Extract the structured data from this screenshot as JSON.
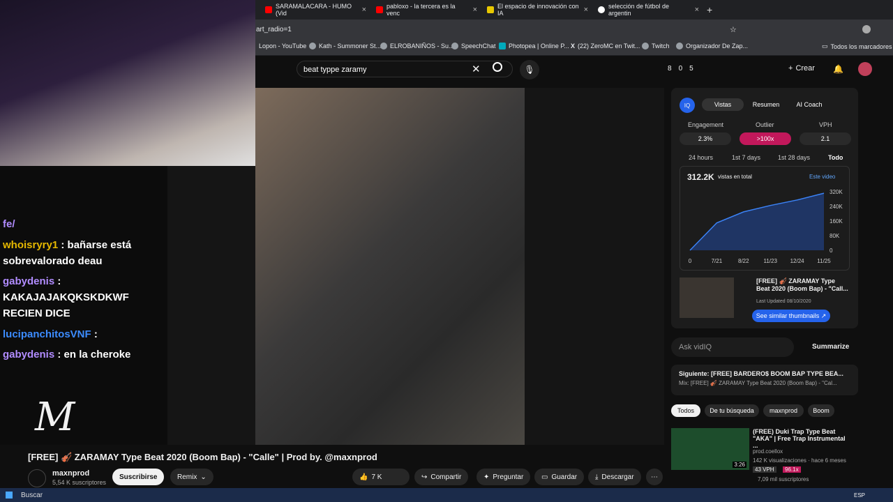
{
  "tabs": [
    {
      "label": "SARAMALACARA - HUMO (Vid",
      "color": "#ff0000"
    },
    {
      "label": "pabloxo - la tercera es la venc",
      "color": "#ff0000"
    },
    {
      "label": "El espacio de innovación con IA",
      "color": "#e8c800"
    },
    {
      "label": "selección de fútbol de argentin",
      "color": "#fff"
    }
  ],
  "address": {
    "text": "art_radio=1"
  },
  "bookmarks": [
    "Lopon - YouTube",
    "Kath - Summoner St...",
    "ELROBANIÑOS - Su...",
    "SpeechChat",
    "Photopea | Online P...",
    "(22) ZeroMC en Twit...",
    "Twitch",
    "Organizador De Zap..."
  ],
  "bookmarks_all": "Todos los marcadores",
  "search": {
    "query": "beat typpe zaramy"
  },
  "header": {
    "counts": [
      "8",
      "0",
      "5"
    ],
    "create": "Crear"
  },
  "chat": {
    "lines": [
      {
        "user": "",
        "text": "fe/",
        "color": "#b18cff"
      },
      {
        "user": "whoisryry1",
        "text": ": bañarse está sobrevalorado deau",
        "color": "#e6b800"
      },
      {
        "user": "gabydenis",
        "text": ":",
        "color": "#b18cff"
      },
      {
        "user": "",
        "text": "KAKAJAJAKQKSKDKWF RECIEN DICE",
        "color": "#fff"
      },
      {
        "user": "lucipanchitosVNF",
        "text": ":",
        "color": "#3c8cff"
      },
      {
        "user": "gabydenis",
        "text": ": en la cheroke",
        "color": "#b18cff"
      }
    ]
  },
  "video": {
    "title": "[FREE] 🎻 ZARAMAY Type Beat 2020 (Boom Bap) - \"Calle\" | Prod by. @maxnprod",
    "channel": "maxnprod",
    "subs": "5,54 K suscriptores",
    "subscribe": "Suscribirse",
    "remix": "Remix",
    "likes": "7 K",
    "share": "Compartir",
    "ask": "Preguntar",
    "save": "Guardar",
    "download": "Descargar"
  },
  "vidiq": {
    "tabs": [
      "Vistas",
      "Resumen",
      "AI Coach"
    ],
    "metrics": [
      {
        "label": "Engagement",
        "value": "2.3%"
      },
      {
        "label": "Outlier",
        "value": ">100x"
      },
      {
        "label": "VPH",
        "value": "2.1"
      }
    ],
    "ranges": [
      "24 hours",
      "1st 7 days",
      "1st 28 days",
      "Todo"
    ],
    "views": "312.2K",
    "views_label": "vistas en total",
    "legend": "Este video",
    "thumb_title": "[FREE] 🎻 ZARAMAY Type Beat 2020 (Boom Bap) - \"Call...",
    "updated": "Last Updated 08/10/2020",
    "similar": "See similar thumbnails ↗",
    "ask": "Ask vidIQ",
    "summarize": "Summarize"
  },
  "chart_data": {
    "type": "area",
    "x": [
      "0",
      "7/21",
      "8/22",
      "11/23",
      "12/24",
      "11/25"
    ],
    "values": [
      0,
      150,
      210,
      245,
      275,
      312
    ],
    "yticks": [
      "320K",
      "240K",
      "160K",
      "80K",
      "0"
    ],
    "ylim": [
      0,
      320
    ]
  },
  "next": {
    "title": "Siguiente: [FREE] BARDERO$ BOOM BAP TYPE BEA...",
    "sub": "Mix: [FREE] 🎻 ZARAMAY Type Beat 2020 (Boom Bap) - \"Cal..."
  },
  "filters": [
    "Todos",
    "De tu búsqueda",
    "maxnprod",
    "Boom"
  ],
  "rec": {
    "title": "(FREE) Duki Trap Type Beat \"AKA\" | Free Trap Instrumental ...",
    "channel": "prod.coellox",
    "meta": "142 K visualizaciones · hace 6 meses",
    "duration": "3:26",
    "vph": "43 VPH",
    "outlier": "96.1x",
    "subs": "7,09 mil suscriptores"
  },
  "taskbar": {
    "search": "Buscar",
    "lang": "ESP"
  }
}
